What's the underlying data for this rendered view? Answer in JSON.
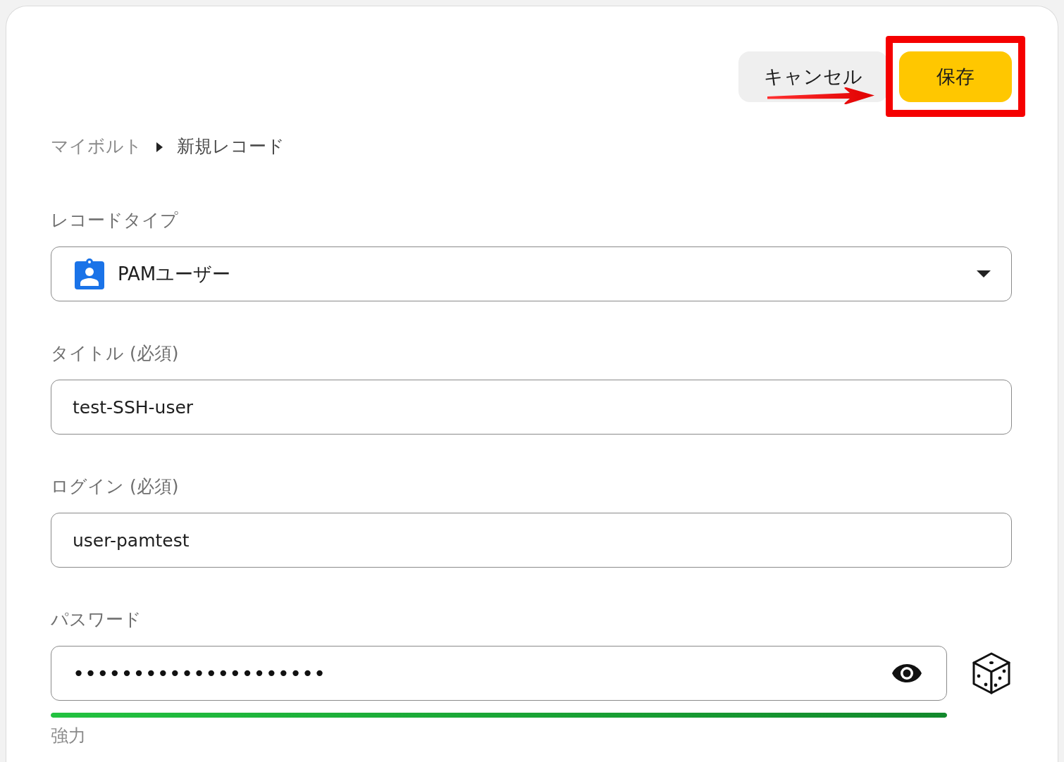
{
  "header_buttons": [
    {
      "kind": "secondary",
      "label": "キャンセル",
      "highlighted": false
    },
    {
      "kind": "primary",
      "label": "保存",
      "highlighted": true
    }
  ],
  "pointer_arrow": true,
  "breadcrumb": [
    {
      "label": "マイボルト",
      "current": false
    },
    {
      "label": "新規レコード",
      "current": true
    }
  ],
  "record_type": {
    "label": "レコードタイプ",
    "value": "PAMユーザー"
  },
  "fields": [
    {
      "label": "タイトル (必須)",
      "value": "test-SSH-user"
    },
    {
      "label": "ログイン (必須)",
      "value": "user-pamtest"
    }
  ],
  "password": {
    "label": "パスワード",
    "value": "•••••••••••••••••••••",
    "strength": {
      "level": 1,
      "label": "強力"
    }
  }
}
